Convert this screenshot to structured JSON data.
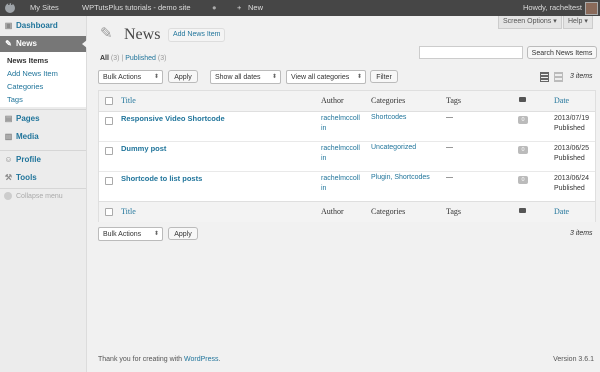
{
  "adminbar": {
    "my_sites": "My Sites",
    "site_name": "WPTutsPlus tutorials - demo site",
    "new_label": "New",
    "howdy": "Howdy, racheltest"
  },
  "screen_options": "Screen Options",
  "help": "Help",
  "sidebar": {
    "dashboard": "Dashboard",
    "news": "News",
    "submenu": [
      "News Items",
      "Add News Item",
      "Categories",
      "Tags"
    ],
    "pages": "Pages",
    "media": "Media",
    "profile": "Profile",
    "tools": "Tools",
    "collapse": "Collapse menu"
  },
  "page": {
    "title": "News",
    "add_new": "Add News Item",
    "views": {
      "all_label": "All",
      "all_count": "(3)",
      "separator": "|",
      "published_label": "Published",
      "published_count": "(3)"
    },
    "search_button": "Search News Items",
    "search_placeholder": ""
  },
  "filters": {
    "bulk_actions": "Bulk Actions",
    "apply": "Apply",
    "dates": "Show all dates",
    "categories": "View all categories",
    "filter": "Filter",
    "items_count": "3 items"
  },
  "table": {
    "headers": {
      "title": "Title",
      "author": "Author",
      "categories": "Categories",
      "tags": "Tags",
      "date": "Date"
    },
    "rows": [
      {
        "title": "Responsive Video Shortcode",
        "author": "rachelmccollin",
        "categories": "Shortcodes",
        "tags": "—",
        "comments": "0",
        "date": "2013/07/19",
        "status": "Published"
      },
      {
        "title": "Dummy post",
        "author": "rachelmccollin",
        "categories": "Uncategorized",
        "tags": "—",
        "comments": "0",
        "date": "2013/06/25",
        "status": "Published"
      },
      {
        "title": "Shortcode to list posts",
        "author": "rachelmccollin",
        "categories": "Plugin, Shortcodes",
        "tags": "—",
        "comments": "0",
        "date": "2013/06/24",
        "status": "Published"
      }
    ]
  },
  "footer": {
    "thanks_prefix": "Thank you for creating with",
    "wordpress_link": "WordPress",
    "thanks_suffix": ".",
    "version": "Version 3.6.1"
  }
}
